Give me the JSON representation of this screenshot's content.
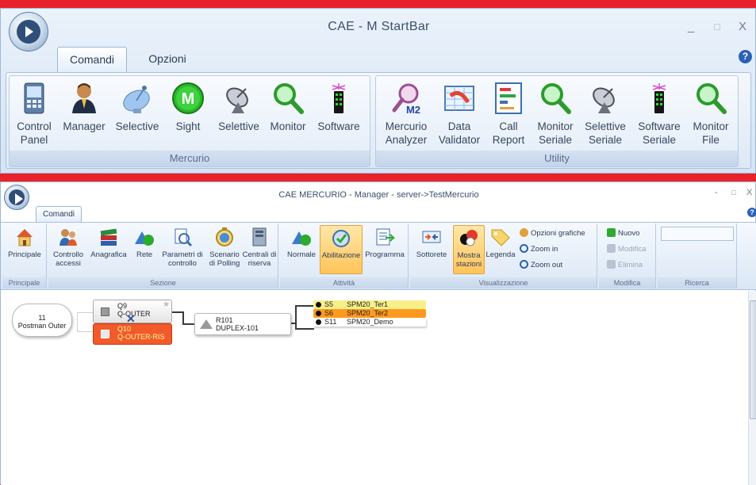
{
  "startbar": {
    "title": "CAE - M   StartBar",
    "tabs": [
      "Comandi",
      "Opzioni"
    ],
    "window_controls": [
      "_",
      "□",
      "X"
    ],
    "help": "?",
    "groups": [
      {
        "caption": "Mercurio",
        "buttons": [
          {
            "label": "Control Panel",
            "icon": "control-panel-icon"
          },
          {
            "label": "Manager",
            "icon": "manager-person-icon"
          },
          {
            "label": "Selective",
            "icon": "satellite-dish-icon"
          },
          {
            "label": "Sight",
            "icon": "sight-m-icon"
          },
          {
            "label": "Selettive",
            "icon": "antenna-icon"
          },
          {
            "label": "Monitor",
            "icon": "magnifier-icon"
          },
          {
            "label": "Software",
            "icon": "radio-device-icon"
          }
        ]
      },
      {
        "caption": "Utility",
        "buttons": [
          {
            "label": "Mercurio Analyzer",
            "icon": "analyzer-m2-icon"
          },
          {
            "label": "Data Validator",
            "icon": "data-validator-icon"
          },
          {
            "label": "Call Report",
            "icon": "call-report-icon"
          },
          {
            "label": "Monitor Seriale",
            "icon": "magnifier-icon"
          },
          {
            "label": "Selettive Seriale",
            "icon": "antenna-icon"
          },
          {
            "label": "Software Seriale",
            "icon": "radio-device-icon"
          },
          {
            "label": "Monitor File",
            "icon": "magnifier-icon"
          }
        ]
      }
    ]
  },
  "manager": {
    "title": "CAE MERCURIO   - Manager - server->TestMercurio",
    "tab": "Comandi",
    "window_controls": [
      "-",
      "□",
      "X"
    ],
    "help": "?",
    "groups": [
      {
        "caption": "Principale",
        "buttons": [
          {
            "label": "Principale",
            "icon": "home-icon"
          }
        ]
      },
      {
        "caption": "Sezione",
        "buttons": [
          {
            "label": "Controllo accessi",
            "icon": "access-control-icon"
          },
          {
            "label": "Anagrafica",
            "icon": "books-icon"
          },
          {
            "label": "Rete",
            "icon": "network-icon"
          },
          {
            "label": "Parametri di controllo",
            "icon": "parameters-icon"
          },
          {
            "label": "Scenario di Polling",
            "icon": "polling-scenario-icon"
          },
          {
            "label": "Centrali di riserva",
            "icon": "backup-centrals-icon"
          }
        ]
      },
      {
        "caption": "Attività",
        "buttons": [
          {
            "label": "Normale",
            "icon": "network-icon"
          },
          {
            "label": "Abilitazione",
            "icon": "enable-icon"
          },
          {
            "label": "Programma",
            "icon": "program-icon"
          }
        ]
      },
      {
        "caption": "Visualizzazione",
        "buttons": [
          {
            "label": "Sottorete",
            "icon": "subnet-icon"
          },
          {
            "label": "Mostra stazioni",
            "icon": "show-stations-icon"
          },
          {
            "label": "Legenda",
            "icon": "legend-tag-icon"
          }
        ],
        "small": [
          "Opzioni grafiche",
          "Zoom in",
          "Zoom out"
        ]
      },
      {
        "caption": "Modifica",
        "small": [
          "Nuovo",
          "Modifica",
          "Elimina"
        ]
      },
      {
        "caption": "Ricerca",
        "search_value": ""
      }
    ],
    "diagram": {
      "root": {
        "id": "11",
        "name": "Postman Outer"
      },
      "queues": [
        {
          "id": "Q9",
          "name": "Q-OUTER",
          "state": "normal"
        },
        {
          "id": "Q10",
          "name": "Q-OUTER-RIS",
          "state": "alarm"
        }
      ],
      "relay": {
        "id": "R101",
        "name": "DUPLEX-101"
      },
      "stations": [
        {
          "id": "S5",
          "name": "SPM20_Ter1",
          "color": "#f7f08a"
        },
        {
          "id": "S6",
          "name": "SPM20_Ter2",
          "color": "#ff9a1e"
        },
        {
          "id": "S11",
          "name": "SPM20_Demo",
          "color": "#ffffff"
        }
      ]
    }
  }
}
